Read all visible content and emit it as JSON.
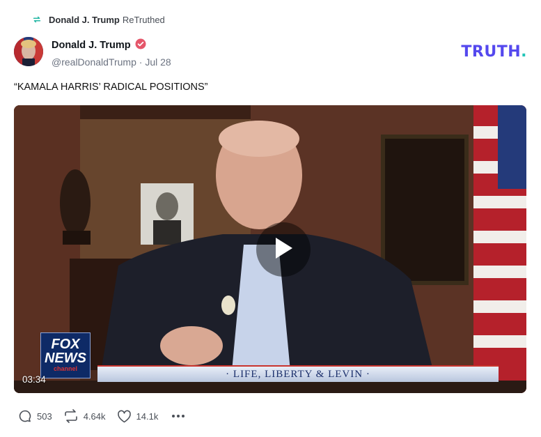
{
  "retruth": {
    "user": "Donald J. Trump",
    "label": "ReTruthed",
    "icon": "retruth-icon"
  },
  "post": {
    "author_name": "Donald J. Trump",
    "handle": "@realDonaldTrump",
    "date": "Jul 28",
    "text": "“KAMALA HARRIS’ RADICAL POSITIONS”",
    "verified_icon": "verified-badge-icon",
    "verified_color": "#e5566a"
  },
  "brand": {
    "logo_main": "TRUTH",
    "logo_dot": ".",
    "color": "#5448ee",
    "dot_color": "#22c5b8"
  },
  "video": {
    "duration": "03:34",
    "lower_third": "· LIFE, LIBERTY & LEVIN ·",
    "network_logo_line1": "FOX",
    "network_logo_line2": "NEWS",
    "network_logo_line3": "channel"
  },
  "actions": {
    "replies": "503",
    "retruths": "4.64k",
    "likes": "14.1k"
  }
}
